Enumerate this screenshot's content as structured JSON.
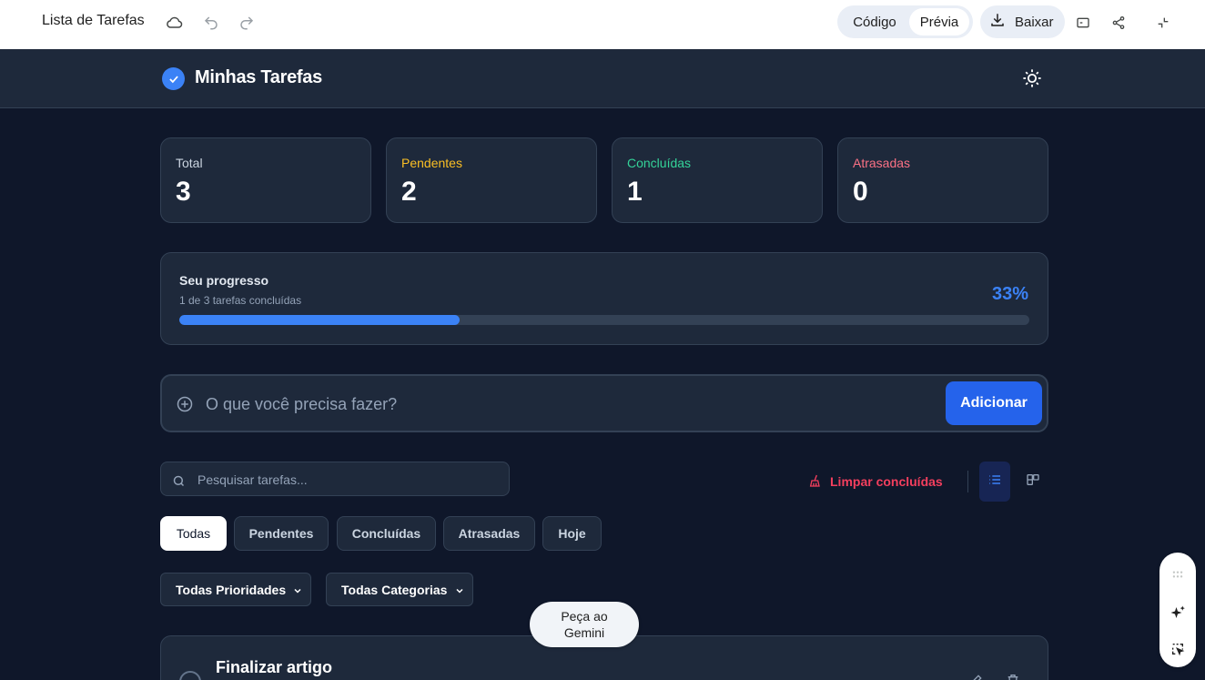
{
  "topbar": {
    "doc_title": "Lista de Tarefas",
    "code_label": "Código",
    "preview_label": "Prévia",
    "download_label": "Baixar",
    "icons": [
      "cloud-icon",
      "undo-icon",
      "redo-icon",
      "download-icon",
      "terminal-icon",
      "share-icon",
      "collapse-icon"
    ]
  },
  "app": {
    "title": "Minhas Tarefas",
    "accent": "#3b82f6"
  },
  "stats": [
    {
      "label": "Total",
      "value": "3",
      "color": "#cbd5e1"
    },
    {
      "label": "Pendentes",
      "value": "2",
      "color": "#fbbf24"
    },
    {
      "label": "Concluídas",
      "value": "1",
      "color": "#34d399"
    },
    {
      "label": "Atrasadas",
      "value": "0",
      "color": "#fb7185"
    }
  ],
  "progress": {
    "title": "Seu progresso",
    "subtitle": "1 de 3 tarefas concluídas",
    "percent_label": "33%",
    "fraction": 0.33
  },
  "add_task": {
    "placeholder": "O que você precisa fazer?",
    "button_label": "Adicionar"
  },
  "search": {
    "placeholder": "Pesquisar tarefas..."
  },
  "clear_completed_label": "Limpar concluídas",
  "filter_tabs": [
    {
      "label": "Todas",
      "active": true
    },
    {
      "label": "Pendentes",
      "active": false
    },
    {
      "label": "Concluídas",
      "active": false
    },
    {
      "label": "Atrasadas",
      "active": false
    },
    {
      "label": "Hoje",
      "active": false
    }
  ],
  "selects": {
    "priority": "Todas Prioridades",
    "category": "Todas Categorias"
  },
  "tasks": [
    {
      "title": "Finalizar artigo"
    }
  ],
  "gemini": {
    "ask_label": "Peça ao Gemini"
  }
}
